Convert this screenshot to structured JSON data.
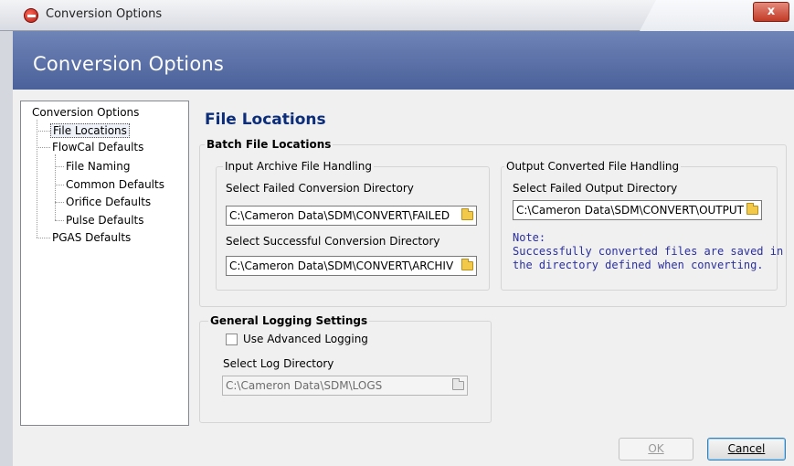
{
  "window": {
    "title": "Conversion Options",
    "close_label": "x"
  },
  "header": {
    "title": "Conversion Options"
  },
  "tree": {
    "root": "Conversion Options",
    "items": {
      "file_locations": "File Locations",
      "flowcal_defaults": "FlowCal Defaults",
      "file_naming": "File Naming",
      "common_defaults": "Common Defaults",
      "orifice_defaults": "Orifice Defaults",
      "pulse_defaults": "Pulse Defaults",
      "pgas_defaults": "PGAS Defaults"
    }
  },
  "main": {
    "heading": "File Locations",
    "batch": {
      "title": "Batch File Locations",
      "input_group": {
        "title": "Input Archive File Handling",
        "failed_label": "Select Failed Conversion Directory",
        "failed_value": "C:\\Cameron Data\\SDM\\CONVERT\\FAILED",
        "success_label": "Select Successful Conversion Directory",
        "success_value": "C:\\Cameron Data\\SDM\\CONVERT\\ARCHIV"
      },
      "output_group": {
        "title": "Output Converted File Handling",
        "failed_label": "Select Failed Output Directory",
        "failed_value": "C:\\Cameron Data\\SDM\\CONVERT\\OUTPUT",
        "note": "Note:\nSuccessfully converted files are saved in\nthe directory defined when converting."
      }
    },
    "logging": {
      "title": "General Logging Settings",
      "advanced_label": "Use Advanced Logging",
      "advanced_checked": false,
      "log_dir_label": "Select Log Directory",
      "log_dir_value": "C:\\Cameron Data\\SDM\\LOGS"
    }
  },
  "buttons": {
    "ok": "OK",
    "cancel": "Cancel"
  },
  "colors": {
    "header_bg": "#5a70a8",
    "heading": "#0b2d7a",
    "note": "#2a2fa0",
    "close": "#c23b26"
  }
}
